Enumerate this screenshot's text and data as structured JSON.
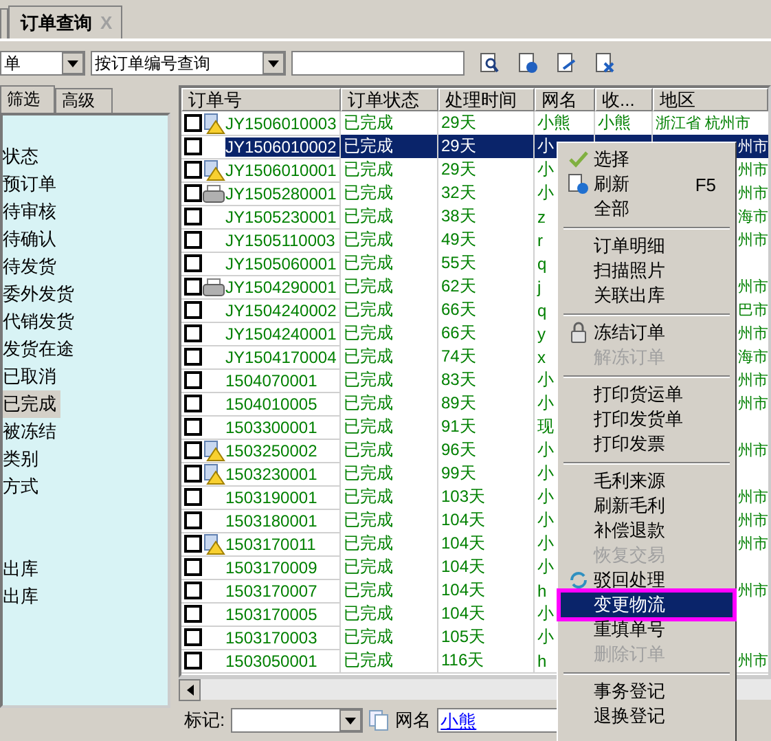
{
  "tabs": [
    {
      "label": "订单查询",
      "close": "X",
      "selected": true
    }
  ],
  "toolbar": {
    "scope": "单",
    "search_mode": "按订单编号查询"
  },
  "sidebar": {
    "tabs": [
      {
        "label": "筛选",
        "selected": true
      },
      {
        "label": "高级",
        "selected": false
      }
    ],
    "groups": [
      [
        {
          "label": "状态",
          "selected": false
        },
        {
          "label": "预订单",
          "selected": false
        },
        {
          "label": "待审核",
          "selected": false
        },
        {
          "label": "待确认",
          "selected": false
        },
        {
          "label": "待发货",
          "selected": false
        },
        {
          "label": "委外发货",
          "selected": false
        },
        {
          "label": "代销发货",
          "selected": false
        },
        {
          "label": "发货在途",
          "selected": false
        },
        {
          "label": "已取消",
          "selected": false
        },
        {
          "label": "已完成",
          "selected": true
        },
        {
          "label": "被冻结",
          "selected": false
        },
        {
          "label": "类别",
          "selected": false
        },
        {
          "label": "方式",
          "selected": false
        }
      ],
      [
        {
          "label": "出库",
          "selected": false
        },
        {
          "label": "出库",
          "selected": false
        }
      ]
    ]
  },
  "table": {
    "columns": [
      "订单号",
      "订单状态",
      "处理时间",
      "网名",
      "收...",
      "地区"
    ],
    "rows": [
      {
        "checked": false,
        "selected": false,
        "kind": "warning",
        "order": "JY1506010003",
        "status": "已完成",
        "time": "29天",
        "nick": "小熊",
        "receiver": "小熊",
        "region": "浙江省 杭州市"
      },
      {
        "checked": false,
        "selected": true,
        "kind": "plain",
        "order": "JY1506010002",
        "status": "已完成",
        "time": "29天",
        "nick": "小",
        "region": "州市"
      },
      {
        "checked": false,
        "selected": false,
        "kind": "warning",
        "order": "JY1506010001",
        "status": "已完成",
        "time": "29天",
        "nick": "小",
        "region": "州市"
      },
      {
        "checked": false,
        "selected": false,
        "kind": "printer",
        "order": "JY1505280001",
        "status": "已完成",
        "time": "32天",
        "nick": "小",
        "region": "州市"
      },
      {
        "checked": false,
        "selected": false,
        "kind": "plain",
        "order": "JY1505230001",
        "status": "已完成",
        "time": "38天",
        "nick": "z",
        "region": "海市"
      },
      {
        "checked": false,
        "selected": false,
        "kind": "plain",
        "order": "JY1505110003",
        "status": "已完成",
        "time": "49天",
        "nick": "r",
        "region": "州市"
      },
      {
        "checked": false,
        "selected": false,
        "kind": "plain",
        "order": "JY1505060001",
        "status": "已完成",
        "time": "55天",
        "nick": "q"
      },
      {
        "checked": false,
        "selected": false,
        "kind": "printer",
        "order": "JY1504290001",
        "status": "已完成",
        "time": "62天",
        "nick": "j",
        "region": "州市"
      },
      {
        "checked": false,
        "selected": false,
        "kind": "plain",
        "order": "JY1504240002",
        "status": "已完成",
        "time": "66天",
        "nick": "q",
        "region": "巴市"
      },
      {
        "checked": false,
        "selected": false,
        "kind": "plain",
        "order": "JY1504240001",
        "status": "已完成",
        "time": "66天",
        "nick": "y",
        "region": "州市"
      },
      {
        "checked": false,
        "selected": false,
        "kind": "plain",
        "order": "JY1504170004",
        "status": "已完成",
        "time": "74天",
        "nick": "x",
        "region": "海市"
      },
      {
        "checked": false,
        "selected": false,
        "kind": "plain",
        "order": "1504070001",
        "status": "已完成",
        "time": "83天",
        "nick": "小",
        "region": "州市"
      },
      {
        "checked": false,
        "selected": false,
        "kind": "plain",
        "order": "1504010005",
        "status": "已完成",
        "time": "89天",
        "nick": "小",
        "region": "州市"
      },
      {
        "checked": false,
        "selected": false,
        "kind": "plain",
        "order": "1503300001",
        "status": "已完成",
        "time": "91天",
        "nick": "现"
      },
      {
        "checked": false,
        "selected": false,
        "kind": "warning",
        "order": "1503250002",
        "status": "已完成",
        "time": "96天",
        "nick": "小",
        "region": "州市"
      },
      {
        "checked": false,
        "selected": false,
        "kind": "warning",
        "order": "1503230001",
        "status": "已完成",
        "time": "99天",
        "nick": "小"
      },
      {
        "checked": false,
        "selected": false,
        "kind": "plain",
        "order": "1503190001",
        "status": "已完成",
        "time": "103天",
        "nick": "小",
        "region": "州市"
      },
      {
        "checked": false,
        "selected": false,
        "kind": "plain",
        "order": "1503180001",
        "status": "已完成",
        "time": "104天",
        "nick": "小",
        "region": "州市"
      },
      {
        "checked": false,
        "selected": false,
        "kind": "warning",
        "order": "1503170011",
        "status": "已完成",
        "time": "104天",
        "nick": "小",
        "region": "州市"
      },
      {
        "checked": false,
        "selected": false,
        "kind": "plain",
        "order": "1503170009",
        "status": "已完成",
        "time": "104天",
        "nick": "小"
      },
      {
        "checked": false,
        "selected": false,
        "kind": "plain",
        "order": "1503170007",
        "status": "已完成",
        "time": "104天",
        "nick": "h",
        "region": "州市"
      },
      {
        "checked": false,
        "selected": false,
        "kind": "plain",
        "order": "1503170005",
        "status": "已完成",
        "time": "104天",
        "nick": "小"
      },
      {
        "checked": false,
        "selected": false,
        "kind": "plain",
        "order": "1503170003",
        "status": "已完成",
        "time": "105天",
        "nick": "小"
      },
      {
        "checked": false,
        "selected": false,
        "kind": "plain",
        "order": "1503050001",
        "status": "已完成",
        "time": "116天",
        "nick": "h",
        "region": "州市"
      }
    ]
  },
  "bottom_bar": {
    "mark_label": "标记:",
    "nick_label": "网名",
    "nick_value": "小熊"
  },
  "context_menu": [
    {
      "kind": "check",
      "label": "选择",
      "disabled": false,
      "selected": false
    },
    {
      "kind": "refresh",
      "label": "刷新",
      "shortcut": "F5",
      "disabled": false,
      "selected": false
    },
    {
      "kind": "item",
      "label": "全部",
      "disabled": false,
      "selected": false
    },
    {
      "kind": "separator"
    },
    {
      "kind": "item",
      "label": "订单明细",
      "disabled": false,
      "selected": false
    },
    {
      "kind": "item",
      "label": "扫描照片",
      "disabled": false,
      "selected": false
    },
    {
      "kind": "item",
      "label": "关联出库",
      "disabled": false,
      "selected": false
    },
    {
      "kind": "separator"
    },
    {
      "kind": "lock",
      "label": "冻结订单",
      "disabled": false,
      "selected": false
    },
    {
      "kind": "item",
      "label": "解冻订单",
      "disabled": true,
      "selected": false
    },
    {
      "kind": "separator"
    },
    {
      "kind": "item",
      "label": "打印货运单",
      "disabled": false,
      "selected": false
    },
    {
      "kind": "item",
      "label": "打印发货单",
      "disabled": false,
      "selected": false
    },
    {
      "kind": "item",
      "label": "打印发票",
      "disabled": false,
      "selected": false
    },
    {
      "kind": "separator"
    },
    {
      "kind": "item",
      "label": "毛利来源",
      "disabled": false,
      "selected": false
    },
    {
      "kind": "item",
      "label": "刷新毛利",
      "disabled": false,
      "selected": false
    },
    {
      "kind": "item",
      "label": "补偿退款",
      "disabled": false,
      "selected": false
    },
    {
      "kind": "item",
      "label": "恢复交易",
      "disabled": true,
      "selected": false
    },
    {
      "kind": "cycle",
      "label": "驳回处理",
      "disabled": false,
      "selected": false
    },
    {
      "kind": "item",
      "label": "变更物流",
      "disabled": false,
      "selected": true
    },
    {
      "kind": "item",
      "label": "重填单号",
      "disabled": false,
      "selected": false
    },
    {
      "kind": "item",
      "label": "删除订单",
      "disabled": true,
      "selected": false
    },
    {
      "kind": "separator"
    },
    {
      "kind": "item",
      "label": "事务登记",
      "disabled": false,
      "selected": false
    },
    {
      "kind": "item",
      "label": "退换登记",
      "disabled": false,
      "selected": false
    }
  ]
}
